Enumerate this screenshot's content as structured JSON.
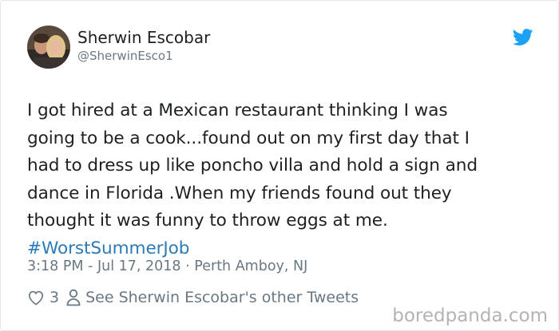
{
  "author": {
    "name": "Sherwin Escobar",
    "handle": "@SherwinEsco1",
    "avatar_icon": "avatar-photo"
  },
  "platform_icon": "twitter-bird-icon",
  "colors": {
    "text": "#1c2022",
    "secondary": "#697882",
    "link": "#2b7bb9",
    "twitter_blue": "#1da1f2"
  },
  "tweet": {
    "lines": [
      "I got hired at a Mexican restaurant thinking I was",
      "going to be a cook...found out on my first day that I",
      "had to dress up like poncho villa and hold a sign and",
      "dance in Florida .When my friends found out they",
      "thought it was funny to throw eggs at me."
    ],
    "hashtag": "#WorstSummerJob"
  },
  "meta": {
    "timestamp": "3:18 PM - Jul 17, 2018",
    "separator": "·",
    "location": "Perth Amboy, NJ"
  },
  "actions": {
    "like_count": "3",
    "other_tweets_label": "See Sherwin Escobar's other Tweets"
  },
  "watermark": "boredpanda.com"
}
